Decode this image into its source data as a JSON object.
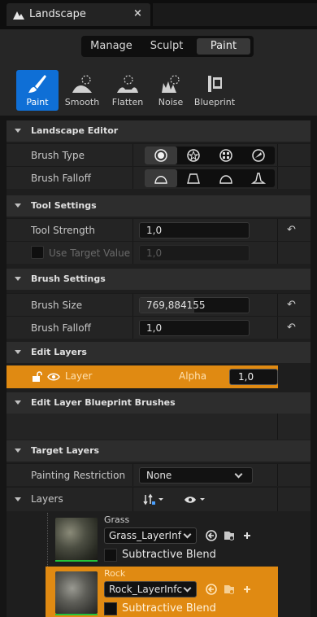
{
  "window": {
    "tab_title": "Landscape",
    "close_glyph": "×",
    "logo_icon": "unreal-logo-icon"
  },
  "modes": [
    {
      "label": "Manage",
      "active": false
    },
    {
      "label": "Sculpt",
      "active": false
    },
    {
      "label": "Paint",
      "active": true
    }
  ],
  "tools": [
    {
      "label": "Paint",
      "icon": "paintbrush-icon",
      "active": true
    },
    {
      "label": "Smooth",
      "icon": "smooth-icon",
      "active": false
    },
    {
      "label": "Flatten",
      "icon": "flatten-icon",
      "active": false
    },
    {
      "label": "Noise",
      "icon": "noise-icon",
      "active": false
    },
    {
      "label": "Blueprint",
      "icon": "blueprint-icon",
      "active": false
    }
  ],
  "landscape_editor": {
    "title": "Landscape Editor",
    "brush_type_label": "Brush Type",
    "brush_types": [
      "circle-brush-icon",
      "alpha-brush-icon",
      "pattern-brush-icon",
      "component-brush-icon"
    ],
    "brush_falloff_label": "Brush Falloff",
    "falloff_types": [
      "smooth-falloff-icon",
      "linear-falloff-icon",
      "spherical-falloff-icon",
      "tip-falloff-icon"
    ]
  },
  "tool_settings": {
    "title": "Tool Settings",
    "strength_label": "Tool Strength",
    "strength_value": "1,0",
    "use_target_label": "Use Target Value",
    "target_value": "1,0"
  },
  "brush_settings": {
    "title": "Brush Settings",
    "size_label": "Brush Size",
    "size_value": "769,884155",
    "size_fill": 0.5,
    "falloff_label": "Brush Falloff",
    "falloff_value": "1,0"
  },
  "edit_layers": {
    "title": "Edit Layers",
    "layer_name": "Layer",
    "alpha_label": "Alpha",
    "alpha_value": "1,0"
  },
  "blueprint_brushes": {
    "title": "Edit Layer Blueprint Brushes"
  },
  "target_layers": {
    "title": "Target Layers",
    "restriction_label": "Painting Restriction",
    "restriction_value": "None",
    "layers_label": "Layers",
    "items": [
      {
        "name": "Grass",
        "info": "Grass_LayerInf",
        "subtractive_label": "Subtractive Blend",
        "selected": false
      },
      {
        "name": "Rock",
        "info": "Rock_LayerInfc",
        "subtractive_label": "Subtractive Blend",
        "selected": true
      }
    ]
  },
  "colors": {
    "accent": "#0f6fd6",
    "selection": "#e08a12",
    "panel": "#242424"
  }
}
